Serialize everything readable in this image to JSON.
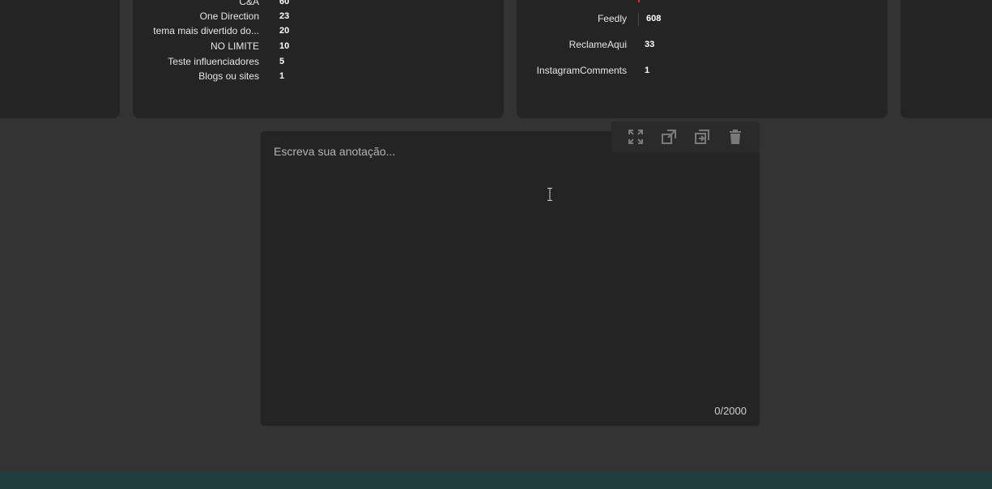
{
  "card1": {
    "rows": [
      {
        "label": "C&A",
        "value": "60"
      },
      {
        "label": "One Direction",
        "value": "23"
      },
      {
        "label": "tema mais divertido do...",
        "value": "20"
      },
      {
        "label": "NO LIMITE",
        "value": "10"
      },
      {
        "label": "Teste influenciadores",
        "value": "5"
      },
      {
        "label": "Blogs ou sites",
        "value": "1"
      }
    ]
  },
  "card2": {
    "rows": [
      {
        "label": "Feedly",
        "value": "608"
      },
      {
        "label": "ReclameAqui",
        "value": "33"
      },
      {
        "label": "InstagramComments",
        "value": "1"
      }
    ]
  },
  "note": {
    "placeholder": "Escreva sua anotação...",
    "counter": "0/2000",
    "toolbar": {
      "icons": [
        "expand-icon",
        "open-external-icon",
        "duplicate-icon",
        "trash-icon"
      ]
    }
  },
  "colors": {
    "background": "#333333",
    "card": "#242424",
    "footer": "#213d3d",
    "accent_red": "#d9342b"
  }
}
